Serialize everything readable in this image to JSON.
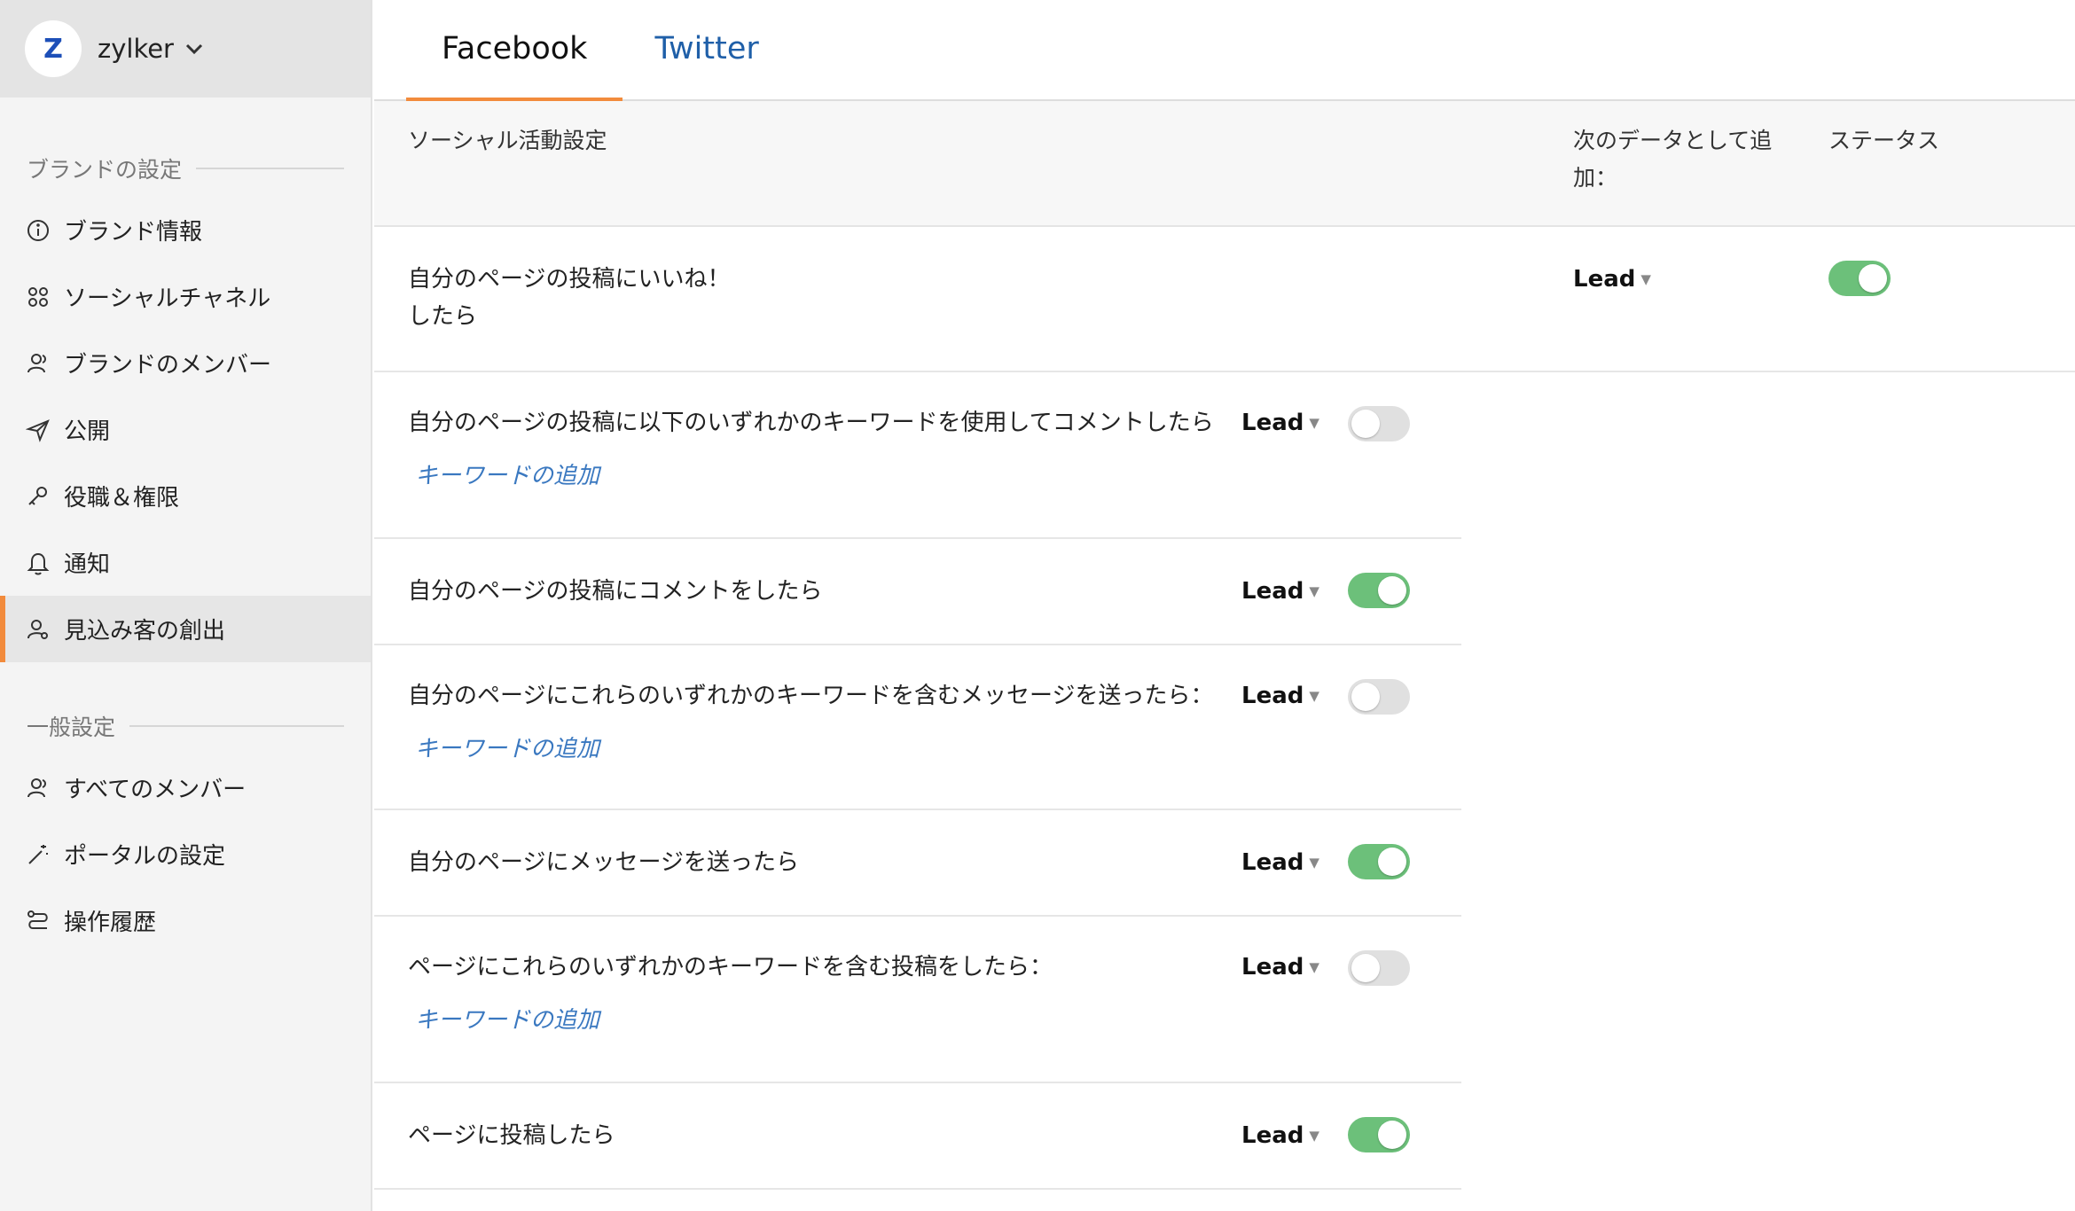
{
  "brand": {
    "logo_letter": "Z",
    "name": "zylker"
  },
  "sidebar": {
    "section1_title": "ブランドの設定",
    "section1_items": [
      {
        "label": "ブランド情報",
        "icon": "info-icon"
      },
      {
        "label": "ソーシャルチャネル",
        "icon": "social-channels-icon"
      },
      {
        "label": "ブランドのメンバー",
        "icon": "members-icon"
      },
      {
        "label": "公開",
        "icon": "send-icon"
      },
      {
        "label": "役職＆権限",
        "icon": "key-icon"
      },
      {
        "label": "通知",
        "icon": "bell-icon"
      },
      {
        "label": "見込み客の創出",
        "icon": "lead-user-icon",
        "active": true
      }
    ],
    "section2_title": "一般設定",
    "section2_items": [
      {
        "label": "すべてのメンバー",
        "icon": "members-icon"
      },
      {
        "label": "ポータルの設定",
        "icon": "magic-wand-icon"
      },
      {
        "label": "操作履歴",
        "icon": "route-icon"
      }
    ]
  },
  "tabs": [
    {
      "label": "Facebook",
      "active": true
    },
    {
      "label": "Twitter",
      "active": false
    }
  ],
  "table": {
    "header_activity": "ソーシャル活動設定",
    "header_add_as_line1": "次のデータとして追",
    "header_add_as_line2": "加：",
    "header_status": "ステータス"
  },
  "rows": [
    {
      "text_line1": "自分のページの投稿にいいね！",
      "text_line2": "したら",
      "lead": "Lead",
      "status": true
    },
    {
      "text_line1": "自分のページの投稿に以下のいずれかのキーワードを使用してコメントしたら",
      "lead": "Lead",
      "status": false,
      "keyword_link": "キーワードの追加"
    },
    {
      "text_line1": "自分のページの投稿にコメントをしたら",
      "lead": "Lead",
      "status": true
    },
    {
      "text_line1": "自分のページにこれらのいずれかのキーワードを含むメッセージを送ったら：",
      "lead": "Lead",
      "status": false,
      "keyword_link": "キーワードの追加"
    },
    {
      "text_line1": "自分のページにメッセージを送ったら",
      "lead": "Lead",
      "status": true
    },
    {
      "text_line1": "ページにこれらのいずれかのキーワードを含む投稿をしたら：",
      "lead": "Lead",
      "status": false,
      "keyword_link": "キーワードの追加"
    },
    {
      "text_line1": "ページに投稿したら",
      "lead": "Lead",
      "status": true
    }
  ],
  "colors": {
    "accent": "#f28b3c",
    "toggle_on": "#6cc07a",
    "link": "#3a78c0",
    "tab_inactive": "#1f5fa8"
  }
}
